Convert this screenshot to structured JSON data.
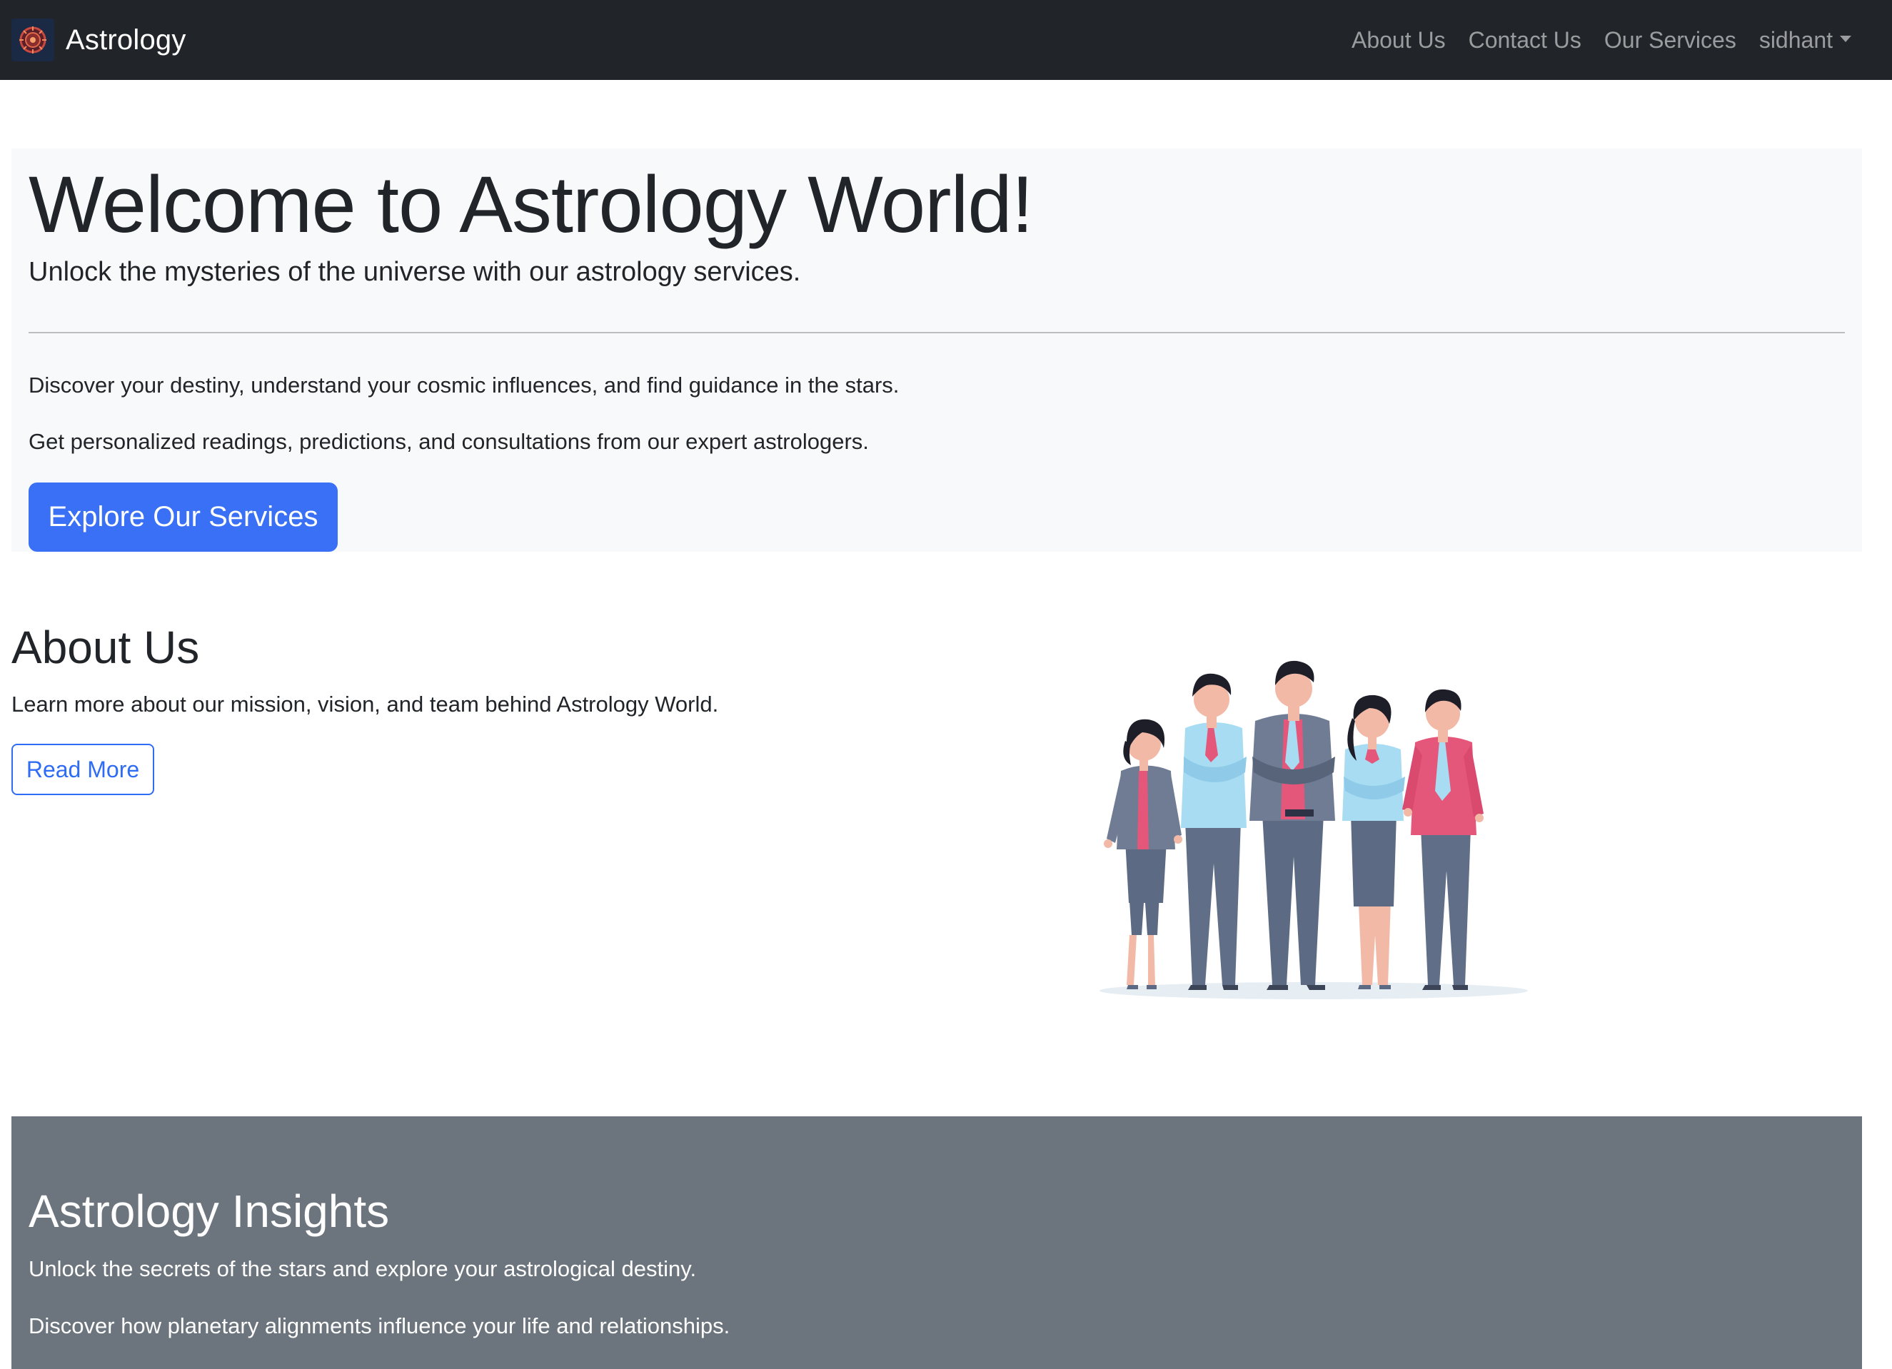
{
  "navbar": {
    "brand": "Astrology",
    "links": [
      "About Us",
      "Contact Us",
      "Our Services"
    ],
    "user": "sidhant"
  },
  "hero": {
    "title": "Welcome to Astrology World!",
    "lead": "Unlock the mysteries of the universe with our astrology services.",
    "paragraph1": "Discover your destiny, understand your cosmic influences, and find guidance in the stars.",
    "paragraph2": "Get personalized readings, predictions, and consultations from our expert astrologers.",
    "button": "Explore Our Services"
  },
  "about": {
    "title": "About Us",
    "text": "Learn more about our mission, vision, and team behind Astrology World.",
    "button": "Read More"
  },
  "insights": {
    "title": "Astrology Insights",
    "paragraph1": "Unlock the secrets of the stars and explore your astrological destiny.",
    "paragraph2": "Discover how planetary alignments influence your life and relationships."
  },
  "colors": {
    "navbar": "#212529",
    "primary": "#3a70f6",
    "hero_bg": "#f8f9fa",
    "insights_bg": "#6c757d"
  }
}
